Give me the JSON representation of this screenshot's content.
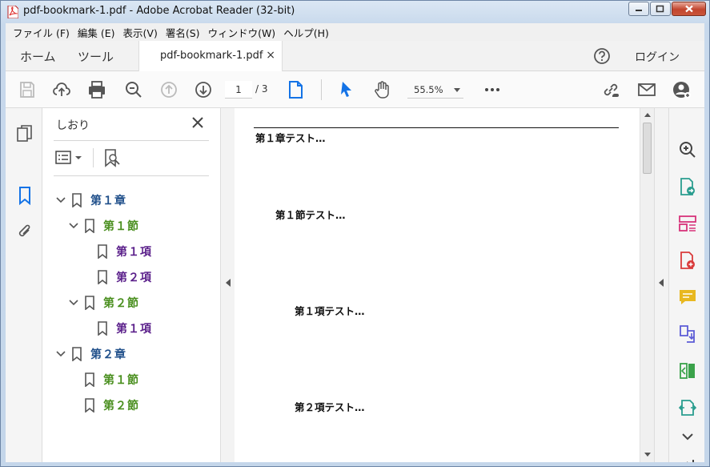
{
  "window": {
    "title": "pdf-bookmark-1.pdf - Adobe Acrobat Reader (32-bit)"
  },
  "menu": [
    "ファイル (F)",
    "編集 (E)",
    "表示(V)",
    "署名(S)",
    "ウィンドウ(W)",
    "ヘルプ(H)"
  ],
  "tabs": {
    "home": "ホーム",
    "tools": "ツール",
    "document": "pdf-bookmark-1.pdf",
    "close": "×",
    "login": "ログイン"
  },
  "toolbar": {
    "page_current": "1",
    "page_total": "/ 3",
    "zoom": "55.5%"
  },
  "bookmarks": {
    "title": "しおり",
    "items": [
      {
        "label": "第１章",
        "level": 0,
        "expanded": true,
        "color": "#1f4f8a"
      },
      {
        "label": "第１節",
        "level": 1,
        "expanded": true,
        "color": "#4a8f1f"
      },
      {
        "label": "第１項",
        "level": 2,
        "color": "#5a1f8a"
      },
      {
        "label": "第２項",
        "level": 2,
        "color": "#5a1f8a"
      },
      {
        "label": "第２節",
        "level": 1,
        "expanded": true,
        "color": "#4a8f1f"
      },
      {
        "label": "第１項",
        "level": 2,
        "color": "#5a1f8a"
      },
      {
        "label": "第２章",
        "level": 0,
        "expanded": true,
        "color": "#1f4f8a"
      },
      {
        "label": "第１節",
        "level": 1,
        "color": "#4a8f1f"
      },
      {
        "label": "第２節",
        "level": 1,
        "color": "#4a8f1f"
      }
    ]
  },
  "document": {
    "lines": [
      {
        "text": "第１章テスト…"
      },
      {
        "text": "第１節テスト…"
      },
      {
        "text": "第１項テスト…"
      },
      {
        "text": "第２項テスト…"
      }
    ]
  },
  "colors": {
    "accent_blue": "#1473e6",
    "chapter": "#1f4f8a",
    "section": "#4a8f1f",
    "item": "#5a1f8a"
  }
}
